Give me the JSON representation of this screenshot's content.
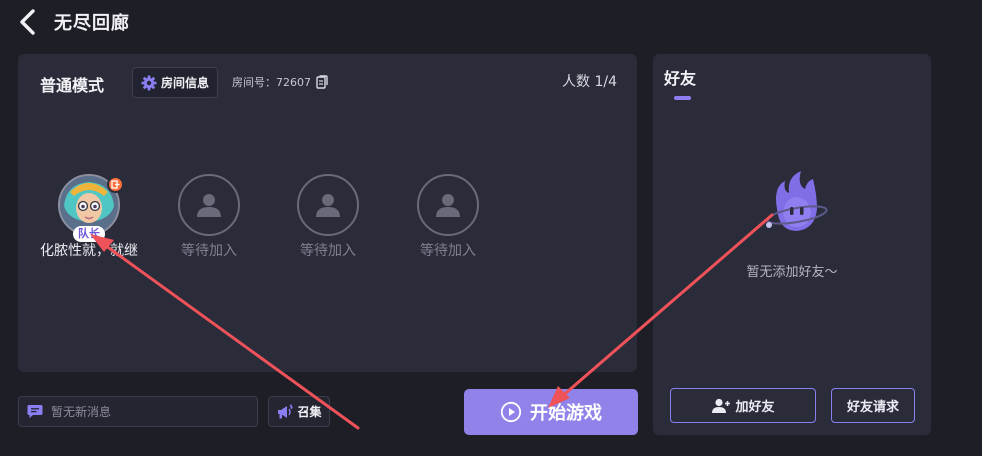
{
  "header": {
    "title": "无尽回廊",
    "back_icon": "chevron-left-icon"
  },
  "room": {
    "mode_title": "普通模式",
    "info_button_label": "房间信息",
    "room_number_label": "房间号：72607",
    "people_count": "人数 1/4",
    "slots": [
      {
        "label": "化脓性就，就继",
        "badge": "队长",
        "occupied": true
      },
      {
        "label": "等待加入",
        "occupied": false
      },
      {
        "label": "等待加入",
        "occupied": false
      },
      {
        "label": "等待加入",
        "occupied": false
      }
    ]
  },
  "bottom": {
    "message_placeholder": "暂无新消息",
    "summon_label": "召集",
    "start_label": "开始游戏"
  },
  "friends": {
    "title": "好友",
    "empty_text": "暂无添加好友～",
    "add_friend_label": "加好友",
    "friend_request_label": "好友请求"
  },
  "colors": {
    "accent": "#8f83ea",
    "panel": "#2b2c3a",
    "background": "#1d1e26",
    "annotation_arrow": "#f0525a"
  }
}
